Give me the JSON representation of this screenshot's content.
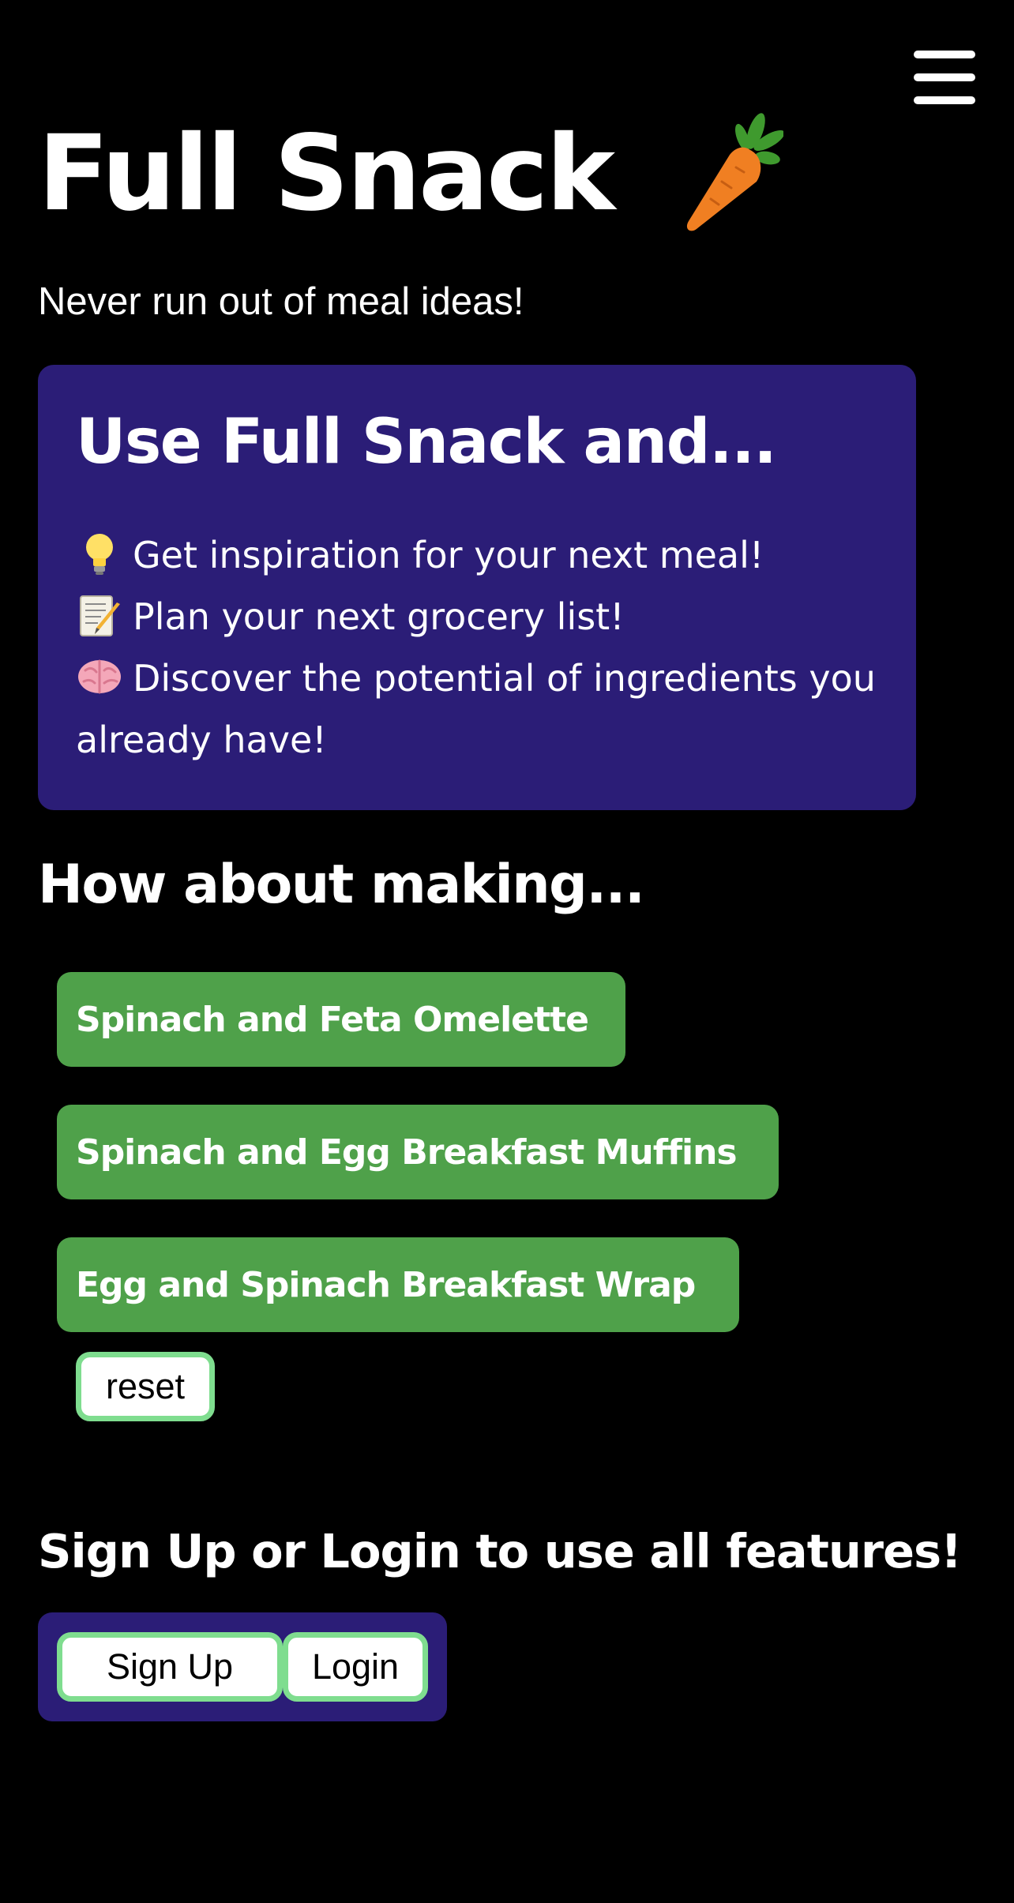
{
  "header": {
    "title": "Full Snack",
    "title_icon": "carrot-icon",
    "menu_icon": "hamburger-menu-icon",
    "tagline": "Never run out of meal ideas!"
  },
  "promo": {
    "heading": "Use Full Snack and...",
    "benefits": [
      {
        "icon": "lightbulb-icon",
        "text": "Get inspiration for your next meal!"
      },
      {
        "icon": "memo-icon",
        "text": "Plan your next grocery list!"
      },
      {
        "icon": "brain-icon",
        "text": "Discover the potential of ingredients you already have!"
      }
    ]
  },
  "suggestions": {
    "heading": "How about making...",
    "recipes": [
      "Spinach and Feta Omelette",
      "Spinach and Egg Breakfast Muffins",
      "Egg and Spinach Breakfast Wrap"
    ],
    "reset_label": "reset"
  },
  "auth": {
    "heading": "Sign Up or Login to use all features!",
    "signup_label": "Sign Up",
    "login_label": "Login"
  },
  "colors": {
    "background": "#000000",
    "panel": "#2b1d77",
    "recipe_button": "#4fa14a",
    "button_border": "#7fdd8f",
    "text": "#ffffff"
  }
}
